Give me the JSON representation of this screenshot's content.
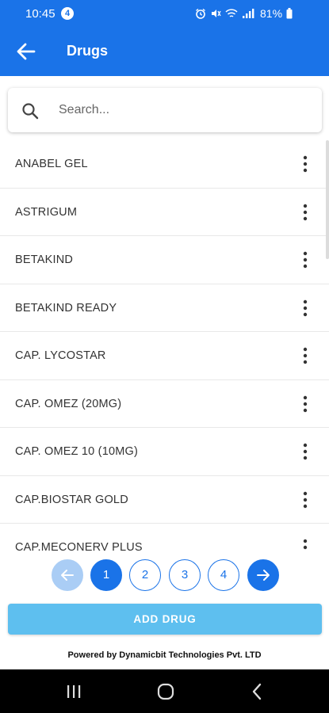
{
  "status_bar": {
    "time": "10:45",
    "notification_count": "4",
    "battery": "81%"
  },
  "app_bar": {
    "title": "Drugs"
  },
  "search": {
    "placeholder": "Search..."
  },
  "drugs": [
    "ANABEL GEL",
    "ASTRIGUM",
    "BETAKIND",
    "BETAKIND READY",
    "CAP. LYCOSTAR",
    "CAP. OMEZ (20MG)",
    "CAP. OMEZ 10 (10MG)",
    "CAP.BIOSTAR GOLD",
    "CAP.MECONERV PLUS"
  ],
  "pagination": {
    "pages": [
      "1",
      "2",
      "3",
      "4"
    ],
    "current_page": "1"
  },
  "add_button": "ADD DRUG",
  "footer": "Powered by Dynamicbit Technologies Pvt. LTD",
  "colors": {
    "primary": "#1a73e8",
    "add_button": "#5ebfef",
    "disabled_page": "#aacdf5"
  }
}
